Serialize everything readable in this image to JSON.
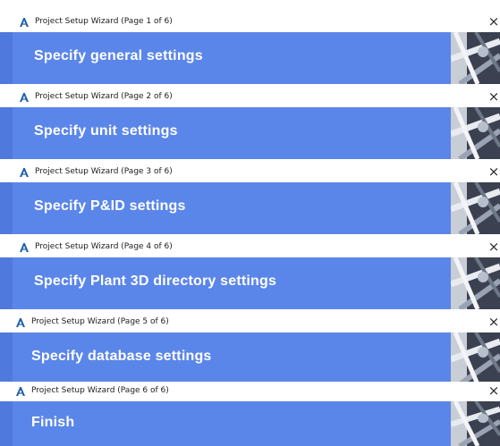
{
  "pages": [
    {
      "title": "Project Setup Wizard (Page 1 of 6)",
      "heading": "Specify general settings"
    },
    {
      "title": "Project Setup Wizard (Page 2 of 6)",
      "heading": "Specify unit settings"
    },
    {
      "title": "Project Setup Wizard (Page 3 of 6)",
      "heading": "Specify P&ID settings"
    },
    {
      "title": "Project Setup Wizard (Page 4 of 6)",
      "heading": "Specify Plant 3D directory settings"
    },
    {
      "title": "Project Setup Wizard (Page 5 of 6)",
      "heading": "Specify database settings"
    },
    {
      "title": "Project Setup Wizard (Page 6 of 6)",
      "heading": "Finish"
    }
  ],
  "close_glyph": "×",
  "colors": {
    "banner": "#5b86e9",
    "icon": "#1d5fa8"
  },
  "icons": {
    "app": "autodesk-a-icon",
    "close": "close-icon",
    "art": "pipe-illustration-icon"
  }
}
